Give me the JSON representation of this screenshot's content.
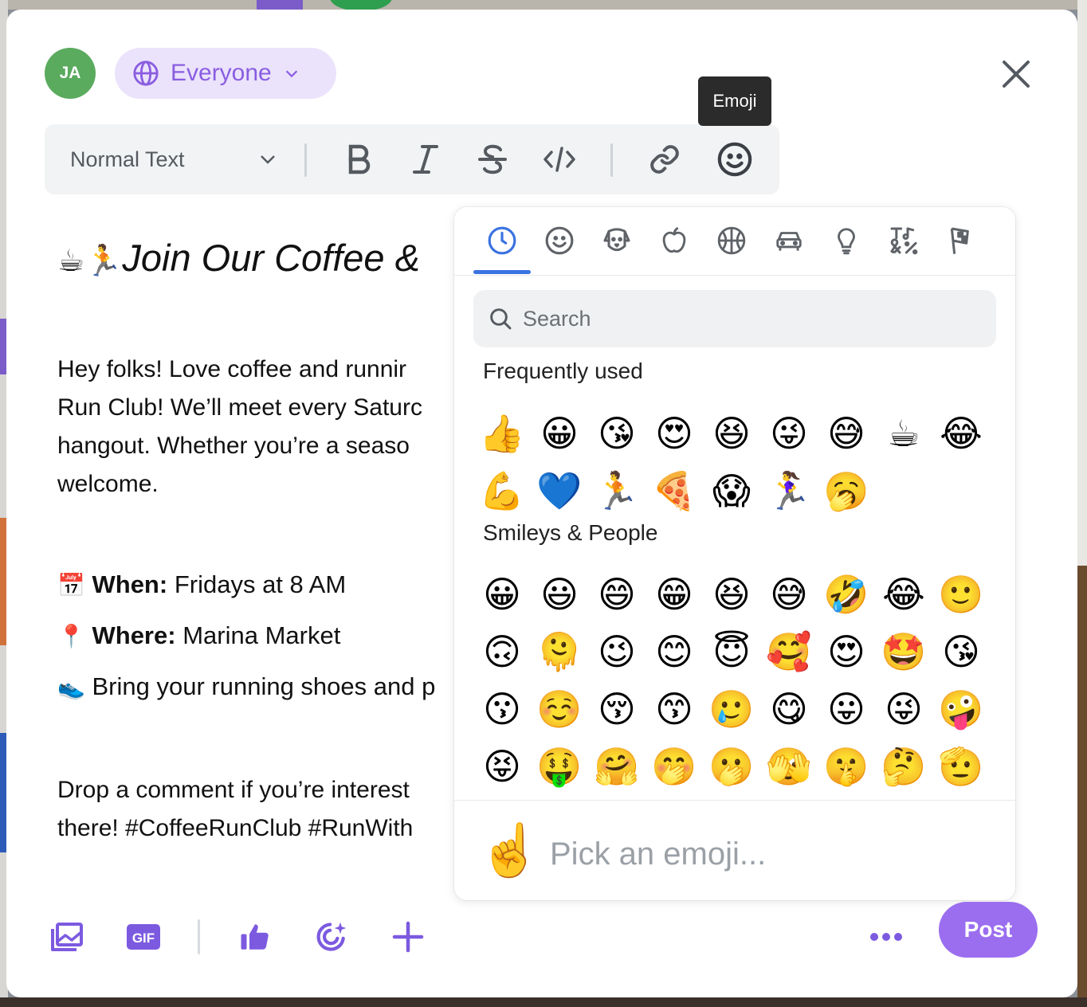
{
  "composer": {
    "avatar_initials": "JA",
    "audience_label": "Everyone",
    "close_icon": "close-icon"
  },
  "tooltip": {
    "text": "Emoji"
  },
  "toolbar": {
    "text_style": "Normal Text",
    "buttons": [
      "bold",
      "italic",
      "strikethrough",
      "code",
      "link",
      "emoji"
    ]
  },
  "post": {
    "title_emoji": "☕🏃",
    "title": "Join Our Coffee &",
    "para1": [
      "Hey folks! Love coffee and runnir",
      "Run Club! We’ll meet every Saturc",
      "hangout. Whether you’re a seaso",
      "welcome."
    ],
    "when_emoji": "📅",
    "when_label": "When:",
    "when_value": "Fridays at 8 AM",
    "where_emoji": "📍",
    "where_label": "Where:",
    "where_value": "Marina Market",
    "bring_emoji": "👟",
    "bring_text": "Bring your running shoes and p",
    "para2": [
      "Drop a comment if you’re interest",
      "there! #CoffeeRunClub #RunWith"
    ]
  },
  "emoji_picker": {
    "categories": [
      "recent",
      "smileys",
      "animals",
      "food",
      "activity",
      "travel",
      "objects",
      "symbols",
      "flags"
    ],
    "active_category": "recent",
    "search_placeholder": "Search",
    "frequently_used_title": "Frequently used",
    "frequently_used": [
      "👍",
      "😀",
      "😘",
      "😍",
      "😆",
      "😜",
      "😅",
      "☕",
      "😂",
      "💪",
      "💙",
      "🏃",
      "🍕",
      "😱",
      "🏃‍♀️",
      "🥱"
    ],
    "smileys_title": "Smileys & People",
    "smileys": [
      "😀",
      "😃",
      "😄",
      "😁",
      "😆",
      "😅",
      "🤣",
      "😂",
      "🙂",
      "🙃",
      "🫠",
      "😉",
      "😊",
      "😇",
      "🥰",
      "😍",
      "🤩",
      "😘",
      "😗",
      "☺️",
      "😚",
      "😙",
      "🥲",
      "😋",
      "😛",
      "😜",
      "🤪",
      "😝",
      "🤑",
      "🤗",
      "🤭",
      "🫢",
      "🫣",
      "🤫",
      "🤔",
      "🫡"
    ],
    "preview_emoji": "☝️",
    "preview_text": "Pick an emoji..."
  },
  "bottom_bar": {
    "gif_label": "GIF",
    "post_label": "Post"
  },
  "colors": {
    "accent": "#9b6ef0",
    "picker_accent": "#3a72e0",
    "avatar": "#5aab5e"
  }
}
